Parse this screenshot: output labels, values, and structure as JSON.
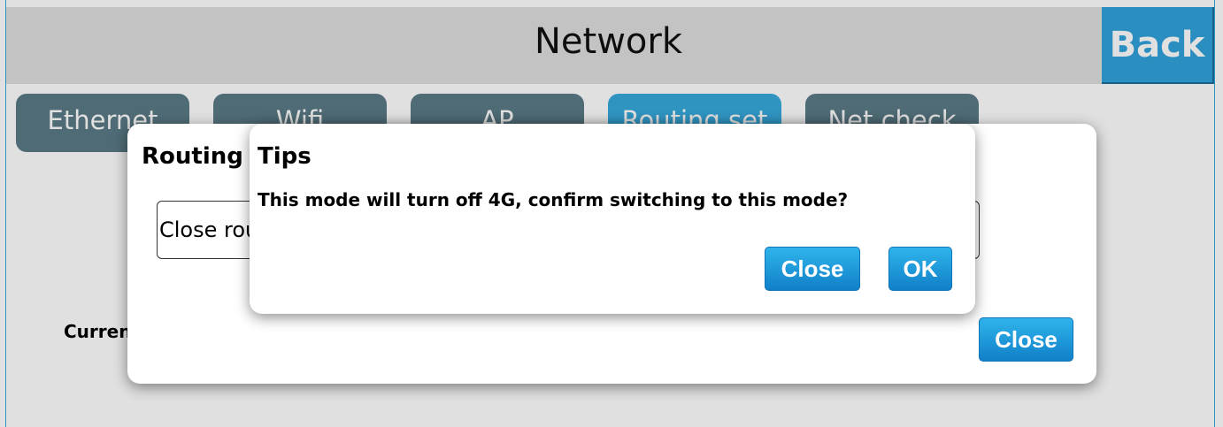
{
  "header": {
    "title": "Network",
    "back_label": "Back"
  },
  "tabs": [
    {
      "label": "Ethernet"
    },
    {
      "label": "Wifi"
    },
    {
      "label": "AP"
    },
    {
      "label": "Routing set",
      "active": true
    },
    {
      "label": "Net check"
    }
  ],
  "background": {
    "current_label": "Current"
  },
  "routing_dialog": {
    "title": "Routing set",
    "select_value": "Close routing",
    "close_label": "Close"
  },
  "tips_dialog": {
    "title": "Tips",
    "message": "This mode will turn off 4G, confirm switching to this mode?",
    "close_label": "Close",
    "ok_label": "OK"
  },
  "colors": {
    "accent": "#31a2dc",
    "tab_inactive": "#5a7a86",
    "header_bg": "#dedede"
  }
}
